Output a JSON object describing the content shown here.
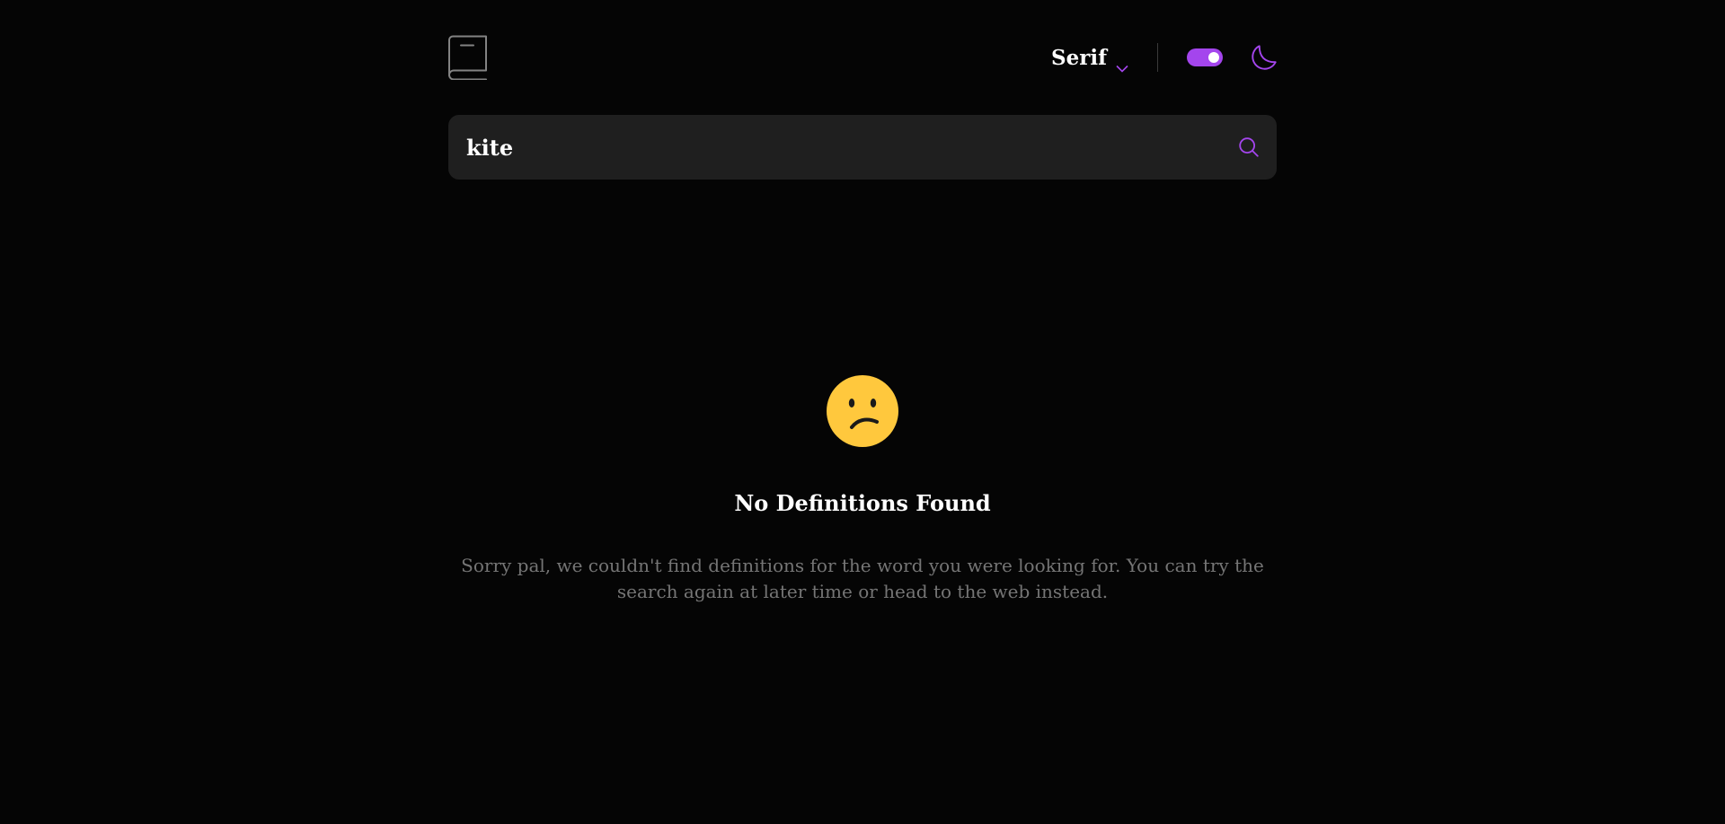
{
  "header": {
    "font_selector": {
      "label": "Serif"
    },
    "theme_toggle": {
      "state": "on"
    }
  },
  "search": {
    "value": "kite",
    "placeholder": ""
  },
  "empty_state": {
    "emoji": "confused-face",
    "title": "No Definitions Found",
    "message": "Sorry pal, we couldn't find definitions for the word you were looking for. You can try the search again at later time or head to the web instead."
  },
  "colors": {
    "background": "#050505",
    "accent": "#a445ed",
    "search_bg": "#1f1f1f",
    "muted_text": "#757575",
    "emoji_yellow": "#ffc83d"
  },
  "icons": {
    "logo": "book-icon",
    "chevron": "chevron-down-icon",
    "moon": "moon-icon",
    "search": "search-icon"
  }
}
